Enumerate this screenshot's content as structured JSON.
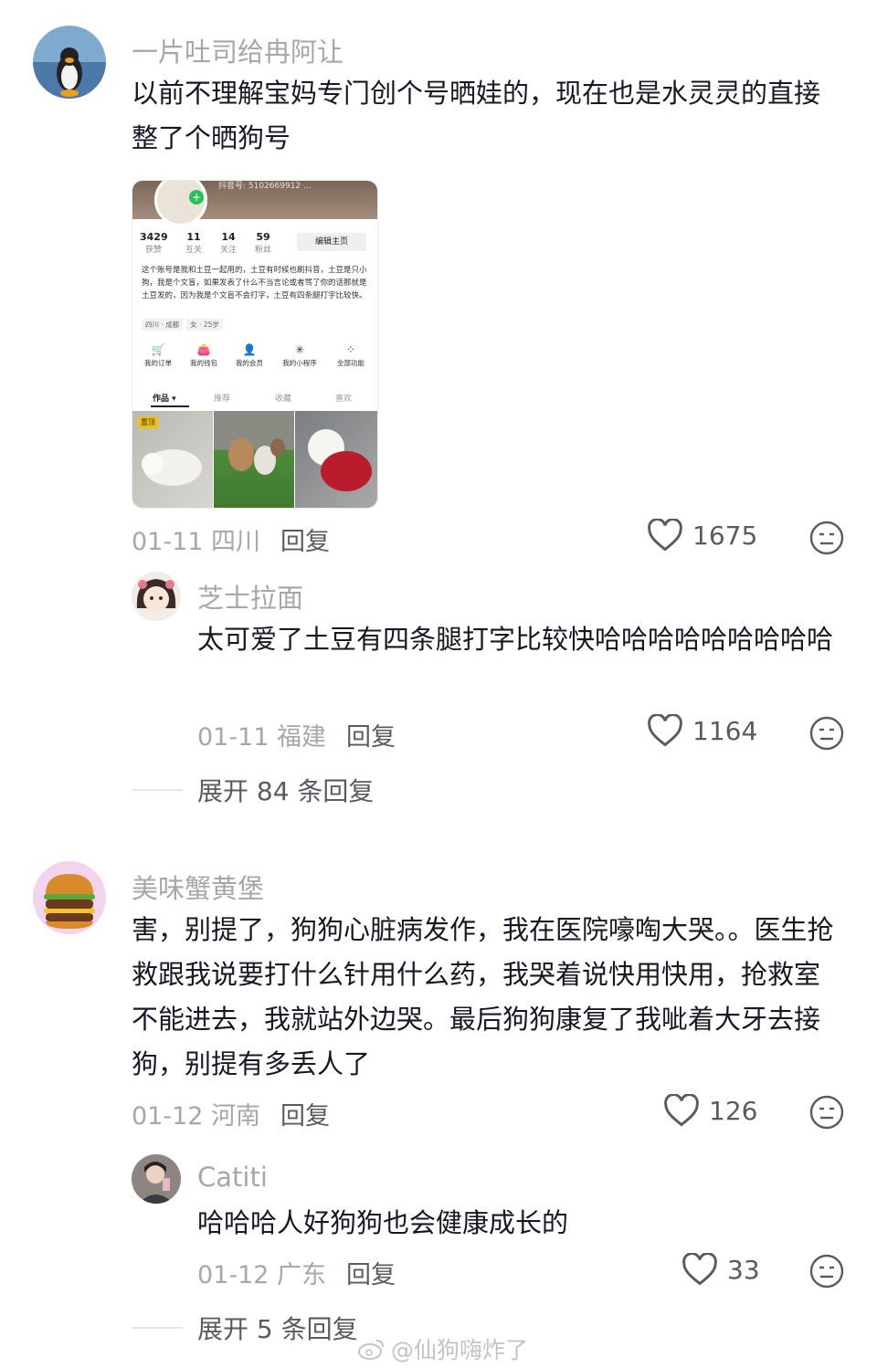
{
  "comments": [
    {
      "username": "一片吐司给冉阿让",
      "text": "以前不理解宝妈专门创个号晒娃的，现在也是水灵灵的直接整了个晒狗号",
      "meta": "01-11 四川",
      "reply_label": "回复",
      "likes": "1675",
      "avatar_icon": "penguin-avatar",
      "screenshot": {
        "uid_line": "抖音号: 5102669912 ...",
        "stats": [
          {
            "num": "3429",
            "label": "获赞"
          },
          {
            "num": "11",
            "label": "互关"
          },
          {
            "num": "14",
            "label": "关注"
          },
          {
            "num": "59",
            "label": "粉丝"
          }
        ],
        "edit_button": "编辑主页",
        "bio": "这个账号是我和土豆一起用的，土豆有时候也刷抖音，土豆是只小狗，我是个文盲，如果发表了什么不当言论或者骂了你的话那就是土豆发的，因为我是个文盲不会打字，土豆有四条腿打字比较快。",
        "tags": [
          "四川 · 成都",
          "女 · 25岁"
        ],
        "functions": [
          {
            "icon": "cart-icon",
            "glyph": "🛒",
            "label": "我的订单"
          },
          {
            "icon": "wallet-icon",
            "glyph": "👛",
            "label": "我的钱包"
          },
          {
            "icon": "member-icon",
            "glyph": "👤",
            "label": "我的会员"
          },
          {
            "icon": "miniapp-icon",
            "glyph": "✳",
            "label": "我的小程序"
          },
          {
            "icon": "grid-icon",
            "glyph": "⁘",
            "label": "全部功能"
          }
        ],
        "tabs": [
          "作品 ▾",
          "推荐",
          "收藏",
          "喜欢"
        ],
        "pinned_label": "置顶"
      }
    },
    {
      "username": "美味蟹黄堡",
      "text": "害，别提了，狗狗心脏病发作，我在医院嚎啕大哭。。医生抢救跟我说要打什么针用什么药，我哭着说快用快用，抢救室不能进去，我就站外边哭。最后狗狗康复了我呲着大牙去接狗，别提有多丢人了",
      "meta": "01-12 河南",
      "reply_label": "回复",
      "likes": "126",
      "avatar_icon": "burger-avatar"
    }
  ],
  "replies": [
    {
      "username": "芝士拉面",
      "text": "太可爱了土豆有四条腿打字比较快哈哈哈哈哈哈哈哈哈",
      "meta": "01-11 福建",
      "reply_label": "回复",
      "likes": "1164",
      "expand": "展开 84 条回复",
      "avatar_icon": "anime-girl-avatar"
    },
    {
      "username": "Catiti",
      "text": "哈哈哈人好狗狗也会健康成长的",
      "meta": "01-12 广东",
      "reply_label": "回复",
      "likes": "33",
      "expand": "展开 5 条回复",
      "avatar_icon": "person-avatar"
    }
  ],
  "watermark": "@仙狗嗨炸了",
  "colors": {
    "meta": "#a6a7ab",
    "text": "#161823",
    "secondary": "#5a5b62"
  }
}
